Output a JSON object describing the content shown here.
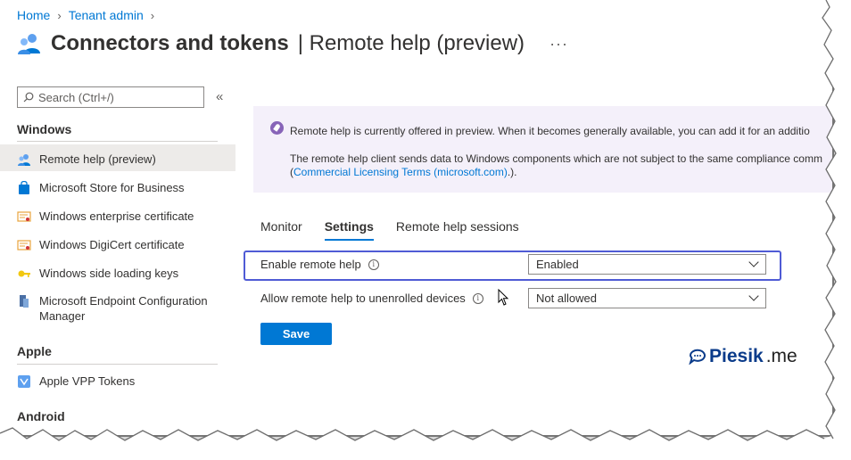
{
  "breadcrumb": {
    "home": "Home",
    "tenant_admin": "Tenant admin"
  },
  "header": {
    "title": "Connectors and tokens",
    "subtitle": "| Remote help (preview)",
    "more": "···"
  },
  "search": {
    "placeholder": "Search (Ctrl+/)"
  },
  "sidebar": {
    "collapse": "«",
    "sections": {
      "windows": "Windows",
      "apple": "Apple",
      "android": "Android"
    },
    "items": [
      {
        "label": "Remote help (preview)",
        "icon": "people-icon"
      },
      {
        "label": "Microsoft Store for Business",
        "icon": "store-icon"
      },
      {
        "label": "Windows enterprise certificate",
        "icon": "certificate-icon"
      },
      {
        "label": "Windows DigiCert certificate",
        "icon": "certificate-icon"
      },
      {
        "label": "Windows side loading keys",
        "icon": "key-icon"
      },
      {
        "label": "Microsoft Endpoint Configuration Manager",
        "icon": "server-icon"
      },
      {
        "label": "Apple VPP Tokens",
        "icon": "vpp-icon"
      }
    ]
  },
  "banner": {
    "line1": "Remote help is currently offered in preview. When it becomes generally available, you can add it for an additio",
    "line2": "The remote help client sends data to Windows components which are not subject to the same compliance comm",
    "line3_prefix": "(",
    "line3_link": "Commercial Licensing Terms (microsoft.com)",
    "line3_suffix": ".)."
  },
  "tabs": [
    "Monitor",
    "Settings",
    "Remote help sessions"
  ],
  "settings": {
    "enable_label": "Enable remote help",
    "enable_value": "Enabled",
    "unenrolled_label": "Allow remote help to unenrolled devices",
    "unenrolled_value": "Not allowed",
    "info_glyph": "i"
  },
  "save_label": "Save",
  "watermark": {
    "bold": "Piesik",
    "normal": ".me"
  },
  "colors": {
    "accent": "#0078d4",
    "highlight": "#4f5bd5",
    "banner_bg": "#f4f0fa",
    "banner_icon": "#8764b8"
  }
}
